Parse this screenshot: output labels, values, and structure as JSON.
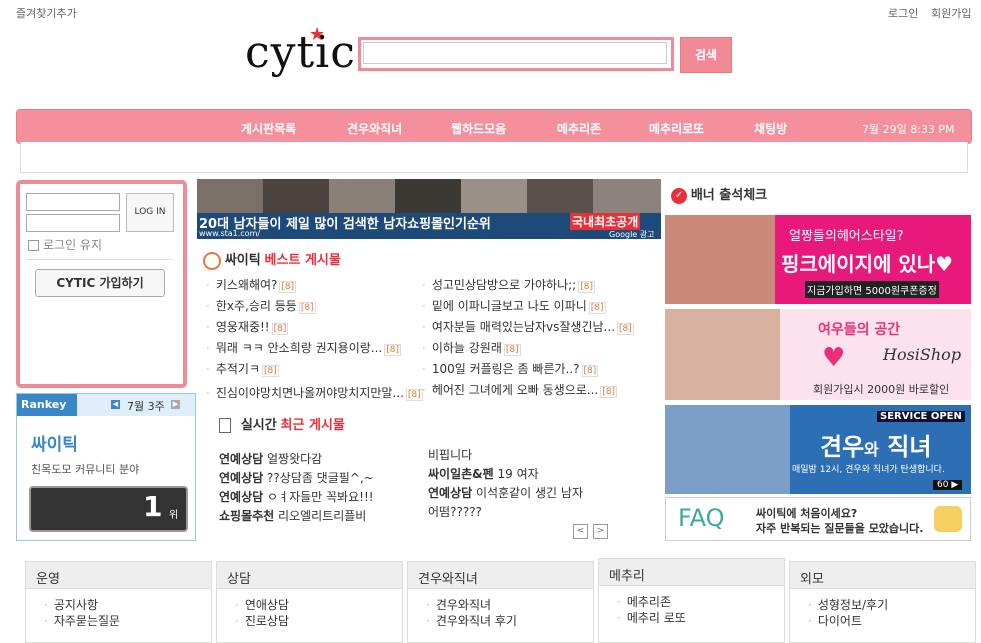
{
  "top": {
    "bookmark": "즐겨찾기추가",
    "login": "로그인",
    "join": "회원가입"
  },
  "logo": {
    "text": "cytic"
  },
  "search": {
    "placeholder": "",
    "button": "검색"
  },
  "nav": {
    "items": [
      "게시판목록",
      "견우와직녀",
      "웹하드모음",
      "메추리존",
      "메추리로또",
      "채팅방"
    ],
    "datetime": "7월 29일  8:33 PM"
  },
  "login_box": {
    "login_button": "LOG IN",
    "keep_login": "로그인 유지",
    "join_button": "CYTIC 가입하기"
  },
  "rankey": {
    "brand": "Rankey",
    "week": "7월 3주",
    "site": "싸이틱",
    "desc": "친목도모 커뮤니티 분야",
    "rank": "1",
    "rank_unit": "위"
  },
  "ad_banner": {
    "text": "20대 남자들이 제일 많이 검색한 남자쇼핑몰인기순위",
    "tag": "국내최초공개",
    "url": "www.sta1.com/",
    "ad_label": "Google 광고"
  },
  "best": {
    "title_a": "싸이틱",
    "title_b": "베스트 게시물",
    "left": [
      {
        "text": "키스왜해여?",
        "count": "[8]"
      },
      {
        "text": "한x주,승리 등등",
        "count": "[8]"
      },
      {
        "text": "영웅재중!!",
        "count": "[8]"
      },
      {
        "text": "뭐래 ㅋㅋ 안소희랑 권지용이랑...",
        "count": "[8]"
      },
      {
        "text": "추적기ㅋ",
        "count": "[8]"
      },
      {
        "text": "진심이야망치면나올꺼야망치지만말...",
        "count": "[8]"
      }
    ],
    "right": [
      {
        "text": "성고민상담방으로 가야하나;;",
        "count": "[8]"
      },
      {
        "text": "밑에 이파니글보고 나도 이파니",
        "count": "[8]"
      },
      {
        "text": "여자분들 매력있는남자vs잘생긴남...",
        "count": "[8]"
      },
      {
        "text": "이하늘 강원래",
        "count": "[8]"
      },
      {
        "text": "100일 커플링은 좀 빠른가..?",
        "count": "[8]"
      },
      {
        "text": "헤어진 그녀에게 오빠 동생으로...",
        "count": "[8]"
      }
    ]
  },
  "recent": {
    "title_a": "실시간",
    "title_b": "최근 게시물",
    "left": [
      {
        "cat": "연예상담",
        "text": "얼짱왓다감"
      },
      {
        "cat": "연예상담",
        "text": "??상담좀 댓글필^,~"
      },
      {
        "cat": "연예상담",
        "text": "ㅇㅕ자들만 꼭봐요!!!"
      },
      {
        "cat": "쇼핑몰추천",
        "text": "리오엘리트리플비"
      }
    ],
    "right": [
      {
        "cat": "",
        "text": "비핍니다"
      },
      {
        "cat": "싸이일촌&펜",
        "text": "19 여자"
      },
      {
        "cat": "연예상담",
        "text": "이석훈같이 생긴 남자"
      },
      {
        "cat": "",
        "text": "어떰?????"
      }
    ]
  },
  "check": {
    "title": "배너 출석체크"
  },
  "banners": {
    "b1": {
      "line1": "얼짱들의헤어스타일?",
      "line2": "핑크에이지에 있나♥",
      "line3": "지금가입하면 5000원쿠폰증정"
    },
    "b2": {
      "line1": "여우들의 공간",
      "shop": "HosiShop",
      "line3": "회원가입시 2000원 바로할인"
    },
    "b3": {
      "service": "SERVICE OPEN",
      "title_a": "견우",
      "title_b": "와",
      "title_c": "직녀",
      "desc": "매일밤 12시, 견우와 직녀가 탄생합니다.",
      "badge": "60 ▶"
    },
    "b4": {
      "faq": "FAQ",
      "line1": "싸이틱에 처음이세요?",
      "line2": "자주 반복되는 질문들을 모았습니다."
    }
  },
  "categories": [
    {
      "title": "운영",
      "items": [
        "공지사항",
        "자주묻는질문"
      ]
    },
    {
      "title": "상담",
      "items": [
        "연애상담",
        "진로상담"
      ]
    },
    {
      "title": "견우와직녀",
      "items": [
        "견우와직녀",
        "견우와직녀 후기"
      ]
    },
    {
      "title": "메추리",
      "items": [
        "메추리존",
        "메추리 로또"
      ]
    },
    {
      "title": "외모",
      "items": [
        "성형정보/후기",
        "다이어트"
      ]
    }
  ],
  "colors": {
    "accent": "#f08a96",
    "title_red": "#e8303a",
    "count_orange": "#e07a3a"
  }
}
